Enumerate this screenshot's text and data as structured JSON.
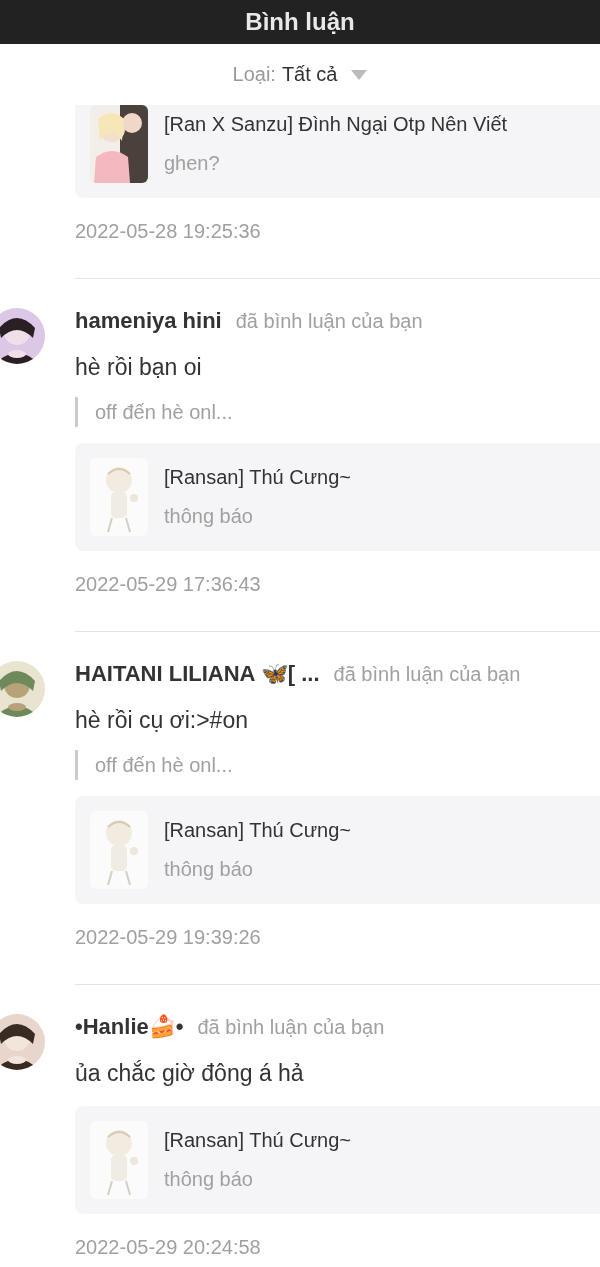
{
  "header": {
    "title": "Bình luận"
  },
  "filter": {
    "label": "Loại:",
    "value": "Tất cả"
  },
  "notifications": [
    {
      "card": {
        "title": "[Ran X Sanzu] Đình Ngại Otp Nên Viết",
        "subtitle": "ghen?"
      },
      "time": "2022-05-28 19:25:36"
    },
    {
      "user": "hameniya hini",
      "action": "đã bình luận của bạn",
      "comment": "hè rồi bạn oi",
      "quote": "off đến hè onl...",
      "card": {
        "title": "[Ransan] Thú Cưng~",
        "subtitle": "thông báo"
      },
      "time": "2022-05-29 17:36:43"
    },
    {
      "user": "HAITANI LILIANA 🦋[ ...",
      "action": "đã bình luận của bạn",
      "comment": "hè rồi cụ ơi:>#on",
      "quote": "off đến hè onl...",
      "card": {
        "title": "[Ransan] Thú Cưng~",
        "subtitle": "thông báo"
      },
      "time": "2022-05-29 19:39:26"
    },
    {
      "user": "•Hanlie🍰•",
      "action": "đã bình luận của bạn",
      "comment": "ủa chắc giờ đông á hả",
      "card": {
        "title": "[Ransan] Thú Cưng~",
        "subtitle": "thông báo"
      },
      "time": "2022-05-29 20:24:58"
    }
  ]
}
